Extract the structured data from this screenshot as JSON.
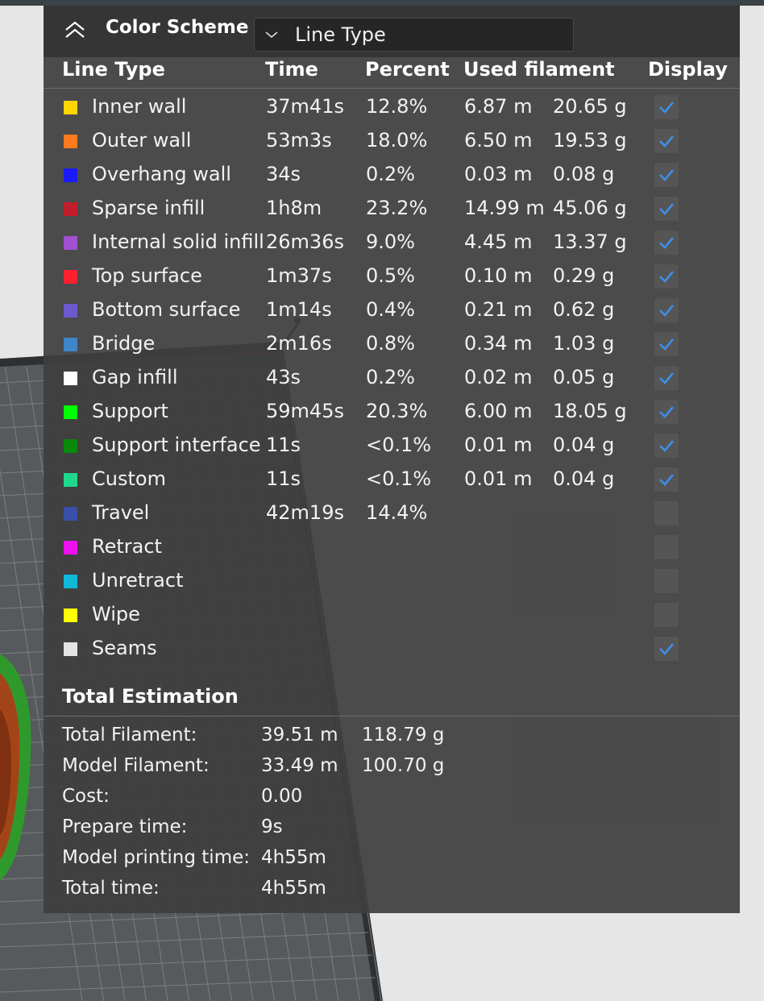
{
  "header": {
    "title": "Color Scheme",
    "selected_scheme": "Line Type"
  },
  "columns": {
    "line_type": "Line Type",
    "time": "Time",
    "percent": "Percent",
    "used_filament": "Used filament",
    "display": "Display"
  },
  "rows": [
    {
      "name": "Inner wall",
      "color": "#ffd700",
      "time": "37m41s",
      "percent": "12.8%",
      "length": "6.87 m",
      "weight": "20.65 g",
      "display": true
    },
    {
      "name": "Outer wall",
      "color": "#ff7a1c",
      "time": "53m3s",
      "percent": "18.0%",
      "length": "6.50 m",
      "weight": "19.53 g",
      "display": true
    },
    {
      "name": "Overhang wall",
      "color": "#1a1aff",
      "time": "34s",
      "percent": "0.2%",
      "length": "0.03 m",
      "weight": "0.08 g",
      "display": true
    },
    {
      "name": "Sparse infill",
      "color": "#c01e28",
      "time": "1h8m",
      "percent": "23.2%",
      "length": "14.99 m",
      "weight": "45.06 g",
      "display": true
    },
    {
      "name": "Internal solid infill",
      "color": "#a050d0",
      "time": "26m36s",
      "percent": "9.0%",
      "length": "4.45 m",
      "weight": "13.37 g",
      "display": true
    },
    {
      "name": "Top surface",
      "color": "#ff2030",
      "time": "1m37s",
      "percent": "0.5%",
      "length": "0.10 m",
      "weight": "0.29 g",
      "display": true
    },
    {
      "name": "Bottom surface",
      "color": "#6a5acd",
      "time": "1m14s",
      "percent": "0.4%",
      "length": "0.21 m",
      "weight": "0.62 g",
      "display": true
    },
    {
      "name": "Bridge",
      "color": "#3e86c8",
      "time": "2m16s",
      "percent": "0.8%",
      "length": "0.34 m",
      "weight": "1.03 g",
      "display": true
    },
    {
      "name": "Gap infill",
      "color": "#ffffff",
      "time": "43s",
      "percent": "0.2%",
      "length": "0.02 m",
      "weight": "0.05 g",
      "display": true
    },
    {
      "name": "Support",
      "color": "#00ff00",
      "time": "59m45s",
      "percent": "20.3%",
      "length": "6.00 m",
      "weight": "18.05 g",
      "display": true
    },
    {
      "name": "Support interface",
      "color": "#0a8a0a",
      "time": "11s",
      "percent": "<0.1%",
      "length": "0.01 m",
      "weight": "0.04 g",
      "display": true
    },
    {
      "name": "Custom",
      "color": "#1ed98c",
      "time": "11s",
      "percent": "<0.1%",
      "length": "0.01 m",
      "weight": "0.04 g",
      "display": true
    },
    {
      "name": "Travel",
      "color": "#3a4fa8",
      "time": "42m19s",
      "percent": "14.4%",
      "length": "",
      "weight": "",
      "display": false
    },
    {
      "name": "Retract",
      "color": "#ee10ee",
      "time": "",
      "percent": "",
      "length": "",
      "weight": "",
      "display": false
    },
    {
      "name": "Unretract",
      "color": "#10b8d8",
      "time": "",
      "percent": "",
      "length": "",
      "weight": "",
      "display": false
    },
    {
      "name": "Wipe",
      "color": "#ffff00",
      "time": "",
      "percent": "",
      "length": "",
      "weight": "",
      "display": false
    },
    {
      "name": "Seams",
      "color": "#e4e4e4",
      "time": "",
      "percent": "",
      "length": "",
      "weight": "",
      "display": true
    }
  ],
  "total_estimation": {
    "title": "Total Estimation",
    "items": [
      {
        "label": "Total Filament:",
        "value": "39.51 m",
        "value2": "118.79 g"
      },
      {
        "label": "Model Filament:",
        "value": "33.49 m",
        "value2": "100.70 g"
      },
      {
        "label": "Cost:",
        "value": "0.00",
        "value2": ""
      },
      {
        "label": "Prepare time:",
        "value": "9s",
        "value2": ""
      },
      {
        "label": "Model printing time:",
        "value": "4h55m",
        "value2": ""
      },
      {
        "label": "Total time:",
        "value": "4h55m",
        "value2": ""
      }
    ]
  },
  "colors": {
    "check": "#3d8fe8",
    "panel_bg": "#3e3e3e",
    "plate": "#5a5e60"
  }
}
